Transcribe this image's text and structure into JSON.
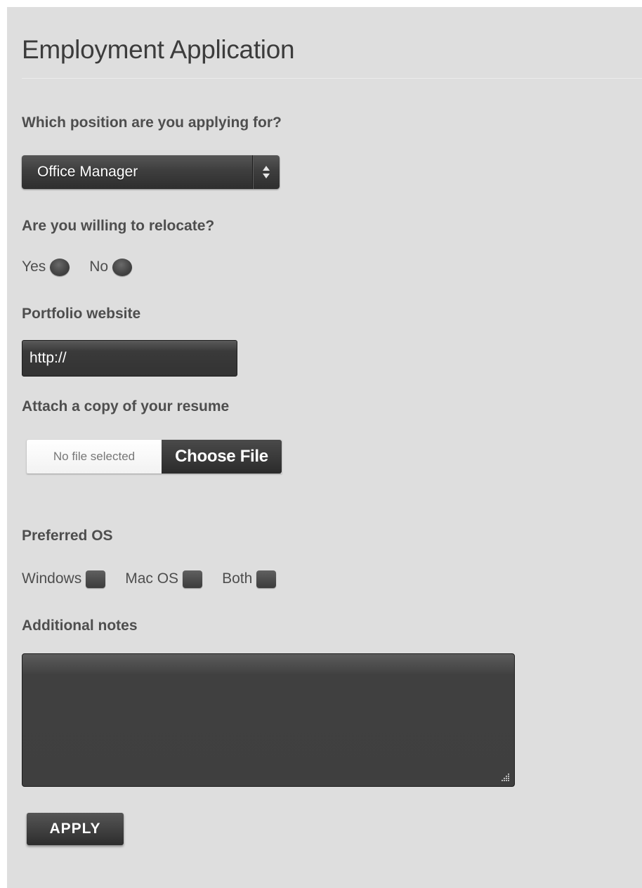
{
  "form": {
    "title": "Employment Application",
    "position": {
      "label": "Which position are you applying for?",
      "selected": "Office Manager"
    },
    "relocate": {
      "label": "Are you willing to relocate?",
      "options": [
        "Yes",
        "No"
      ]
    },
    "portfolio": {
      "label": "Portfolio website",
      "value": "http://"
    },
    "resume": {
      "label": "Attach a copy of your resume",
      "status": "No file selected",
      "button_label": "Choose File"
    },
    "os": {
      "label": "Preferred OS",
      "options": [
        "Windows",
        "Mac OS",
        "Both"
      ]
    },
    "notes": {
      "label": "Additional notes",
      "value": ""
    },
    "submit_label": "APPLY"
  },
  "colors": {
    "panel_background": "#dedede",
    "control_dark": "#3f3f3f",
    "label_text": "#4e4e4e"
  }
}
